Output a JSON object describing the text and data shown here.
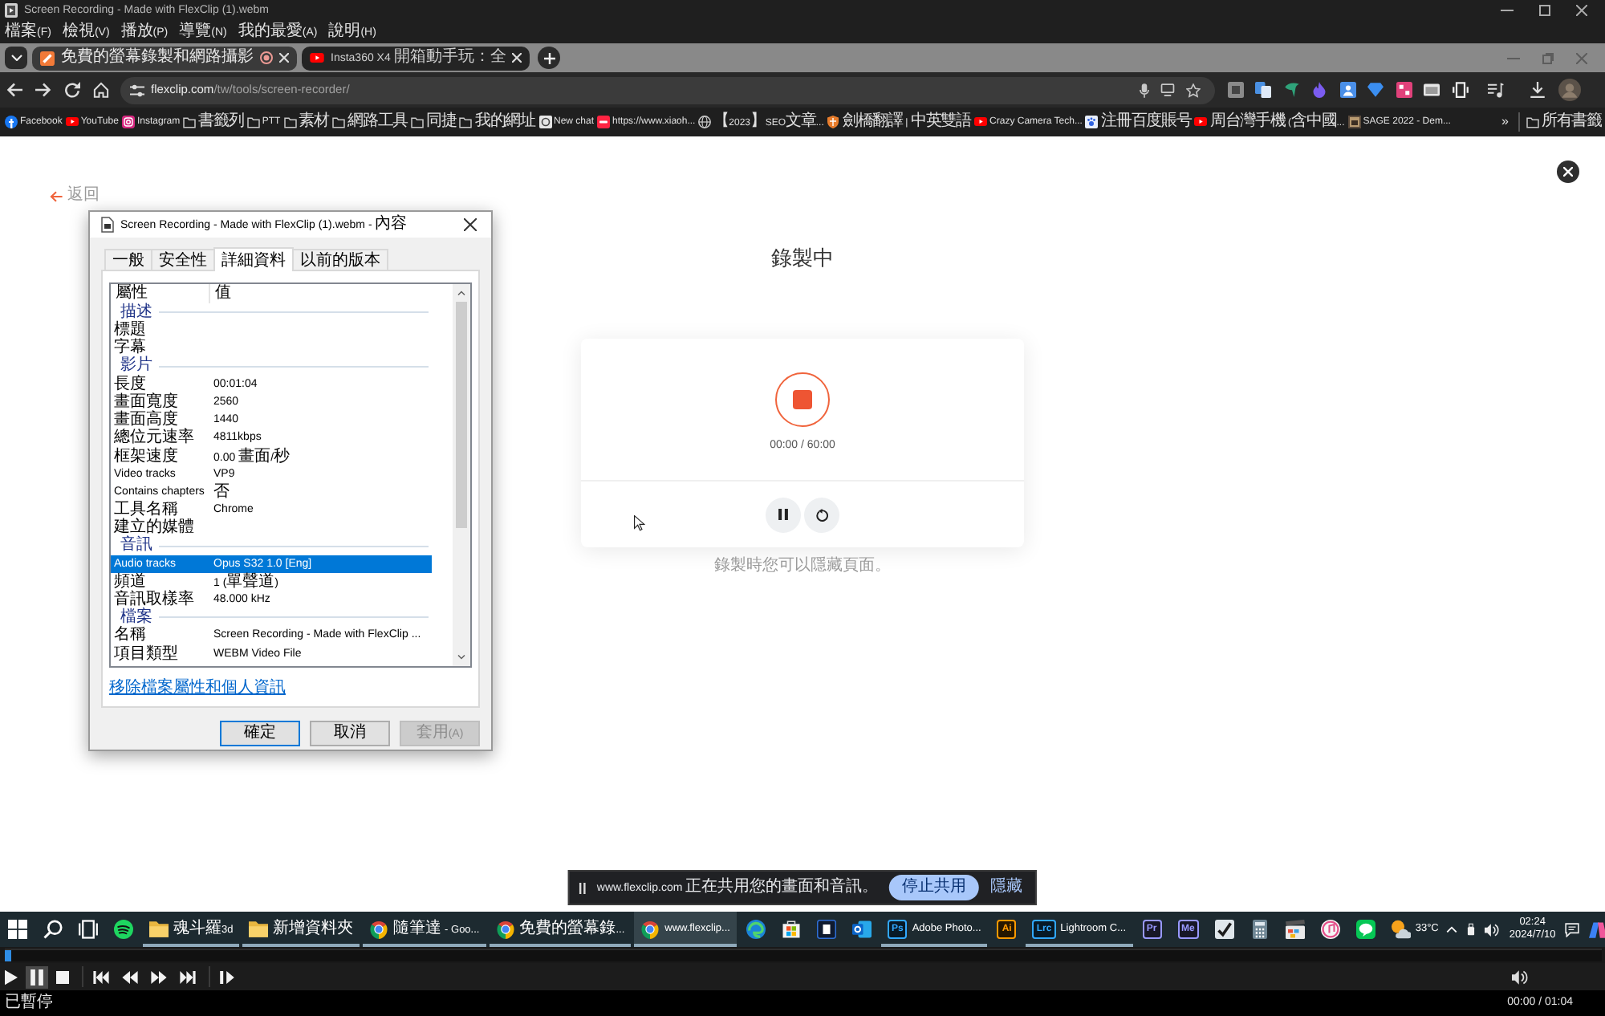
{
  "player": {
    "title": "Screen Recording - Made with FlexClip (1).webm",
    "menu": [
      "檔案(F)",
      "檢視(V)",
      "播放(P)",
      "導覽(N)",
      "我的最愛(A)",
      "說明(H)"
    ]
  },
  "browser": {
    "tabs": [
      {
        "title": "免費的螢幕錄製和網路攝影",
        "kind": "flexclip",
        "recording": true,
        "selected": true
      },
      {
        "title": "Insta360 X4 開箱動手玩：全",
        "kind": "youtube",
        "recording": false,
        "selected": false
      }
    ],
    "url": "flexclip.com/tw/tools/screen-recorder/",
    "bookmarks": [
      {
        "label": "Facebook",
        "kind": "facebook"
      },
      {
        "label": "YouTube",
        "kind": "youtube"
      },
      {
        "label": "Instagram",
        "kind": "instagram"
      },
      {
        "label": "書籤列",
        "kind": "folder"
      },
      {
        "label": "PTT",
        "kind": "folder"
      },
      {
        "label": "素材",
        "kind": "folder"
      },
      {
        "label": "網路工具",
        "kind": "folder"
      },
      {
        "label": "同捷",
        "kind": "folder"
      },
      {
        "label": "我的網址",
        "kind": "folder"
      },
      {
        "label": "New chat",
        "kind": "chat"
      },
      {
        "label": "https://www.xiaoh...",
        "kind": "site"
      },
      {
        "label": "【2023】SEO文章...",
        "kind": "globe"
      },
      {
        "label": "劍橋翻譯 | 中英雙語",
        "kind": "shield"
      },
      {
        "label": "Crazy Camera Tech...",
        "kind": "youtube"
      },
      {
        "label": "注冊百度賬号",
        "kind": "paw"
      },
      {
        "label": "周台灣手機 (含中國...",
        "kind": "youtube"
      },
      {
        "label": "SAGE 2022 - Dem...",
        "kind": "thumb"
      }
    ],
    "overflow": "»",
    "all_bookmarks": "所有書籤"
  },
  "page": {
    "back": "返回",
    "heading": "錄製中",
    "timer": "00:00 / 60:00",
    "hint": "錄製時您可以隱藏頁面。"
  },
  "dialog": {
    "title": "Screen Recording - Made with FlexClip (1).webm - 內容",
    "tabs": [
      {
        "label": "一般",
        "selected": false
      },
      {
        "label": "安全性",
        "selected": false
      },
      {
        "label": "詳細資料",
        "selected": true
      },
      {
        "label": "以前的版本",
        "selected": false
      }
    ],
    "columns": [
      "屬性",
      "值"
    ],
    "sections": [
      {
        "label": "描述",
        "rows": [
          {
            "name": "標題",
            "selected": false
          },
          {
            "name": "字幕",
            "selected": false
          }
        ]
      },
      {
        "label": "影片",
        "rows": [
          {
            "name": "長度",
            "value": "00:01:04",
            "selected": false
          },
          {
            "name": "畫面寬度",
            "value": "2560",
            "selected": false
          },
          {
            "name": "畫面高度",
            "value": "1440",
            "selected": false
          },
          {
            "name": "總位元速率",
            "value": "4811kbps",
            "selected": false
          },
          {
            "name": "框架速度",
            "value": "0.00 畫面/秒",
            "selected": false
          },
          {
            "name": "Video tracks",
            "value": "VP9",
            "selected": false
          },
          {
            "name": "Contains chapters",
            "value": "否",
            "selected": false
          },
          {
            "name": "工具名稱",
            "value": "Chrome",
            "selected": false
          },
          {
            "name": "建立的媒體",
            "selected": false
          }
        ]
      },
      {
        "label": "音訊",
        "rows": [
          {
            "name": "Audio tracks",
            "value": "Opus S32 1.0 [Eng]",
            "selected": true
          },
          {
            "name": "頻道",
            "value": "1 (單聲道)",
            "selected": false
          },
          {
            "name": "音訊取樣率",
            "value": "48.000 kHz",
            "selected": false
          }
        ]
      },
      {
        "label": "檔案",
        "rows": [
          {
            "name": "名稱",
            "value": "Screen Recording - Made with FlexClip ...",
            "selected": false
          },
          {
            "name": "項目類型",
            "value": "WEBM Video File",
            "selected": false
          }
        ]
      }
    ],
    "link": "移除檔案屬性和個人資訊",
    "buttons": [
      {
        "label": "確定",
        "default": true,
        "disabled": false
      },
      {
        "label": "取消",
        "default": false,
        "disabled": false
      },
      {
        "label": "套用(A)",
        "default": false,
        "disabled": true
      }
    ]
  },
  "share_bar": {
    "message": "www.flexclip.com 正在共用您的畫面和音訊。",
    "stop": "停止共用",
    "hide": "隱藏"
  },
  "taskbar": {
    "items": [
      {
        "kind": "start",
        "selected": false,
        "open": false
      },
      {
        "kind": "search",
        "selected": false,
        "open": false
      },
      {
        "kind": "task-view",
        "selected": false,
        "open": false
      },
      {
        "kind": "spotify",
        "selected": false,
        "open": false
      },
      {
        "kind": "folder",
        "label": "魂斗羅3d",
        "selected": false,
        "open": true
      },
      {
        "kind": "folder",
        "label": "新增資料夾",
        "selected": false,
        "open": true
      },
      {
        "kind": "chrome",
        "label": "隨筆達 - Goo...",
        "selected": false,
        "open": true
      },
      {
        "kind": "chrome",
        "label": "免費的螢幕錄...",
        "selected": false,
        "open": true
      },
      {
        "kind": "chrome",
        "label": "www.flexclip...",
        "selected": true,
        "open": true
      },
      {
        "kind": "edge",
        "selected": false,
        "open": false
      },
      {
        "kind": "store",
        "selected": false,
        "open": false
      },
      {
        "kind": "tile",
        "selected": false,
        "open": false
      },
      {
        "kind": "outlook",
        "selected": false,
        "open": false
      },
      {
        "kind": "app",
        "badge": "Ps",
        "color": "#31a8ff",
        "label": "Adobe Photo...",
        "selected": false,
        "open": true
      },
      {
        "kind": "app",
        "badge": "Ai",
        "color": "#ff9a00",
        "selected": false,
        "open": false
      },
      {
        "kind": "app",
        "badge": "Lrc",
        "color": "#31a8ff",
        "label": "Lightroom C...",
        "selected": false,
        "open": true
      },
      {
        "kind": "app",
        "badge": "Pr",
        "color": "#9999ff",
        "selected": false,
        "open": false
      },
      {
        "kind": "app",
        "badge": "Me",
        "color": "#9999ff",
        "selected": false,
        "open": false
      },
      {
        "kind": "checkmark",
        "selected": false,
        "open": false
      },
      {
        "kind": "calculator",
        "selected": false,
        "open": false
      },
      {
        "kind": "clapper",
        "selected": false,
        "open": false
      },
      {
        "kind": "music",
        "selected": false,
        "open": false
      },
      {
        "kind": "line",
        "selected": false,
        "open": false
      },
      {
        "kind": "weather",
        "label": "33°C",
        "selected": false,
        "open": false
      }
    ],
    "time": "02:24",
    "date": "2024/7/10"
  },
  "media_bar": {
    "level": 0,
    "paused": true,
    "status": "已暫停",
    "time": "00:00 / 01:04"
  }
}
